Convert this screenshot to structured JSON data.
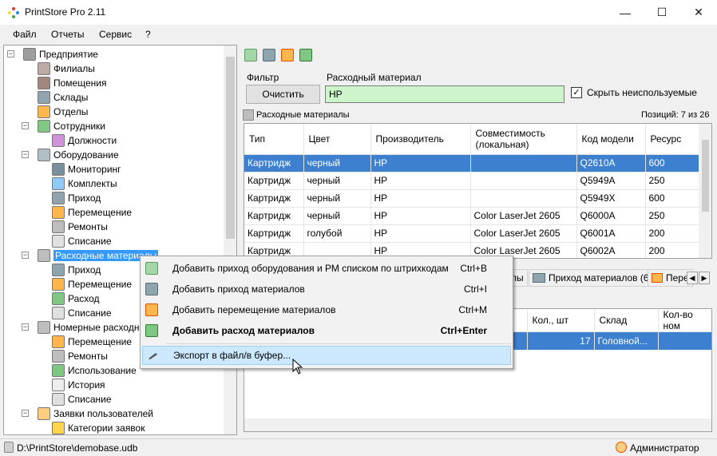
{
  "window": {
    "title": "PrintStore Pro 2.11",
    "min_glyph": "—",
    "max_glyph": "☐",
    "close_glyph": "✕"
  },
  "menu": [
    "Файл",
    "Отчеты",
    "Сервис",
    "?"
  ],
  "tree": {
    "items": [
      {
        "label": "Предприятие",
        "level": 0,
        "icon": "building-icon",
        "expander": "−"
      },
      {
        "label": "Филиалы",
        "level": 1,
        "icon": "branch-icon"
      },
      {
        "label": "Помещения",
        "level": 1,
        "icon": "room-icon"
      },
      {
        "label": "Склады",
        "level": 1,
        "icon": "warehouse-icon"
      },
      {
        "label": "Отделы",
        "level": 1,
        "icon": "department-icon"
      },
      {
        "label": "Сотрудники",
        "level": 1,
        "icon": "employee-icon",
        "expander": "−"
      },
      {
        "label": "Должности",
        "level": 2,
        "icon": "position-icon"
      },
      {
        "label": "Оборудование",
        "level": 1,
        "icon": "equipment-icon",
        "expander": "−"
      },
      {
        "label": "Мониторинг",
        "level": 2,
        "icon": "monitor-icon"
      },
      {
        "label": "Комплекты",
        "level": 2,
        "icon": "kit-icon"
      },
      {
        "label": "Приход",
        "level": 2,
        "icon": "truck-icon"
      },
      {
        "label": "Перемещение",
        "level": 2,
        "icon": "cart-icon"
      },
      {
        "label": "Ремонты",
        "level": 2,
        "icon": "wrench-icon"
      },
      {
        "label": "Списание",
        "level": 2,
        "icon": "writeoff-icon"
      },
      {
        "label": "Расходные материалы",
        "level": 1,
        "icon": "cartridge-icon",
        "expander": "−",
        "selected": true
      },
      {
        "label": "Приход",
        "level": 2,
        "icon": "truck-icon"
      },
      {
        "label": "Перемещение",
        "level": 2,
        "icon": "cart-icon"
      },
      {
        "label": "Расход",
        "level": 2,
        "icon": "consumption-icon"
      },
      {
        "label": "Списание",
        "level": 2,
        "icon": "writeoff-icon"
      },
      {
        "label": "Номерные расходн",
        "level": 1,
        "icon": "serial-consumables-icon",
        "expander": "−"
      },
      {
        "label": "Перемещение",
        "level": 2,
        "icon": "cart-icon"
      },
      {
        "label": "Ремонты",
        "level": 2,
        "icon": "wrench-icon"
      },
      {
        "label": "Использование",
        "level": 2,
        "icon": "consumption-icon"
      },
      {
        "label": "История",
        "level": 2,
        "icon": "history-icon"
      },
      {
        "label": "Списание",
        "level": 2,
        "icon": "writeoff-icon"
      },
      {
        "label": "Заявки пользователей",
        "level": 1,
        "icon": "requests-icon",
        "expander": "−"
      },
      {
        "label": "Категории заявок",
        "level": 2,
        "icon": "request-category-icon"
      }
    ]
  },
  "filter": {
    "label": "Фильтр",
    "clear_button": "Очистить",
    "material_label": "Расходный материал",
    "material_value": "HP",
    "hide_unused_label": "Скрыть неиспользуемые",
    "hide_unused_checked": "✓"
  },
  "grid": {
    "title": "Расходные материалы",
    "positions": "Позиций: 7 из 26",
    "columns": [
      "Тип",
      "Цвет",
      "Производитель",
      "Совместимость (локальная)",
      "Код модели",
      "Ресурс"
    ],
    "rows": [
      [
        "Картридж",
        "черный",
        "HP",
        "",
        "Q2610A",
        "600"
      ],
      [
        "Картридж",
        "черный",
        "HP",
        "",
        "Q5949A",
        "250"
      ],
      [
        "Картридж",
        "черный",
        "HP",
        "",
        "Q5949X",
        "600"
      ],
      [
        "Картридж",
        "черный",
        "HP",
        "Color LaserJet 2605",
        "Q6000A",
        "250"
      ],
      [
        "Картридж",
        "голубой",
        "HP",
        "Color LaserJet 2605",
        "Q6001A",
        "200"
      ],
      [
        "Картридж",
        "",
        "HP",
        "Color LaserJet 2605",
        "Q6002A",
        "200"
      ]
    ]
  },
  "tabs": [
    {
      "label": "лы"
    },
    {
      "label": "Приход материалов (6)"
    },
    {
      "label": "Пере"
    }
  ],
  "lower_grid": {
    "columns": [
      "Кол., шт",
      "Склад",
      "Кол-во ном"
    ],
    "row": [
      "17",
      "Головной..."
    ]
  },
  "context_menu": {
    "items": [
      {
        "label": "Добавить приход оборудования и РМ списком по штрихкодам",
        "shortcut": "Ctrl+B"
      },
      {
        "label": "Добавить приход материалов",
        "shortcut": "Ctrl+I"
      },
      {
        "label": "Добавить перемещение материалов",
        "shortcut": "Ctrl+M"
      },
      {
        "label": "Добавить расход материалов",
        "shortcut": "Ctrl+Enter"
      },
      {
        "label": "Экспорт в файл/в буфер...",
        "shortcut": ""
      }
    ]
  },
  "status": {
    "db_path": "D:\\PrintStore\\demobase.udb",
    "user": "Администратор"
  },
  "colors": {
    "selection": "#3399ff",
    "row_selection": "#3d80d0",
    "filter_bg": "#ccf5cc",
    "menu_hover": "#cce8ff"
  }
}
